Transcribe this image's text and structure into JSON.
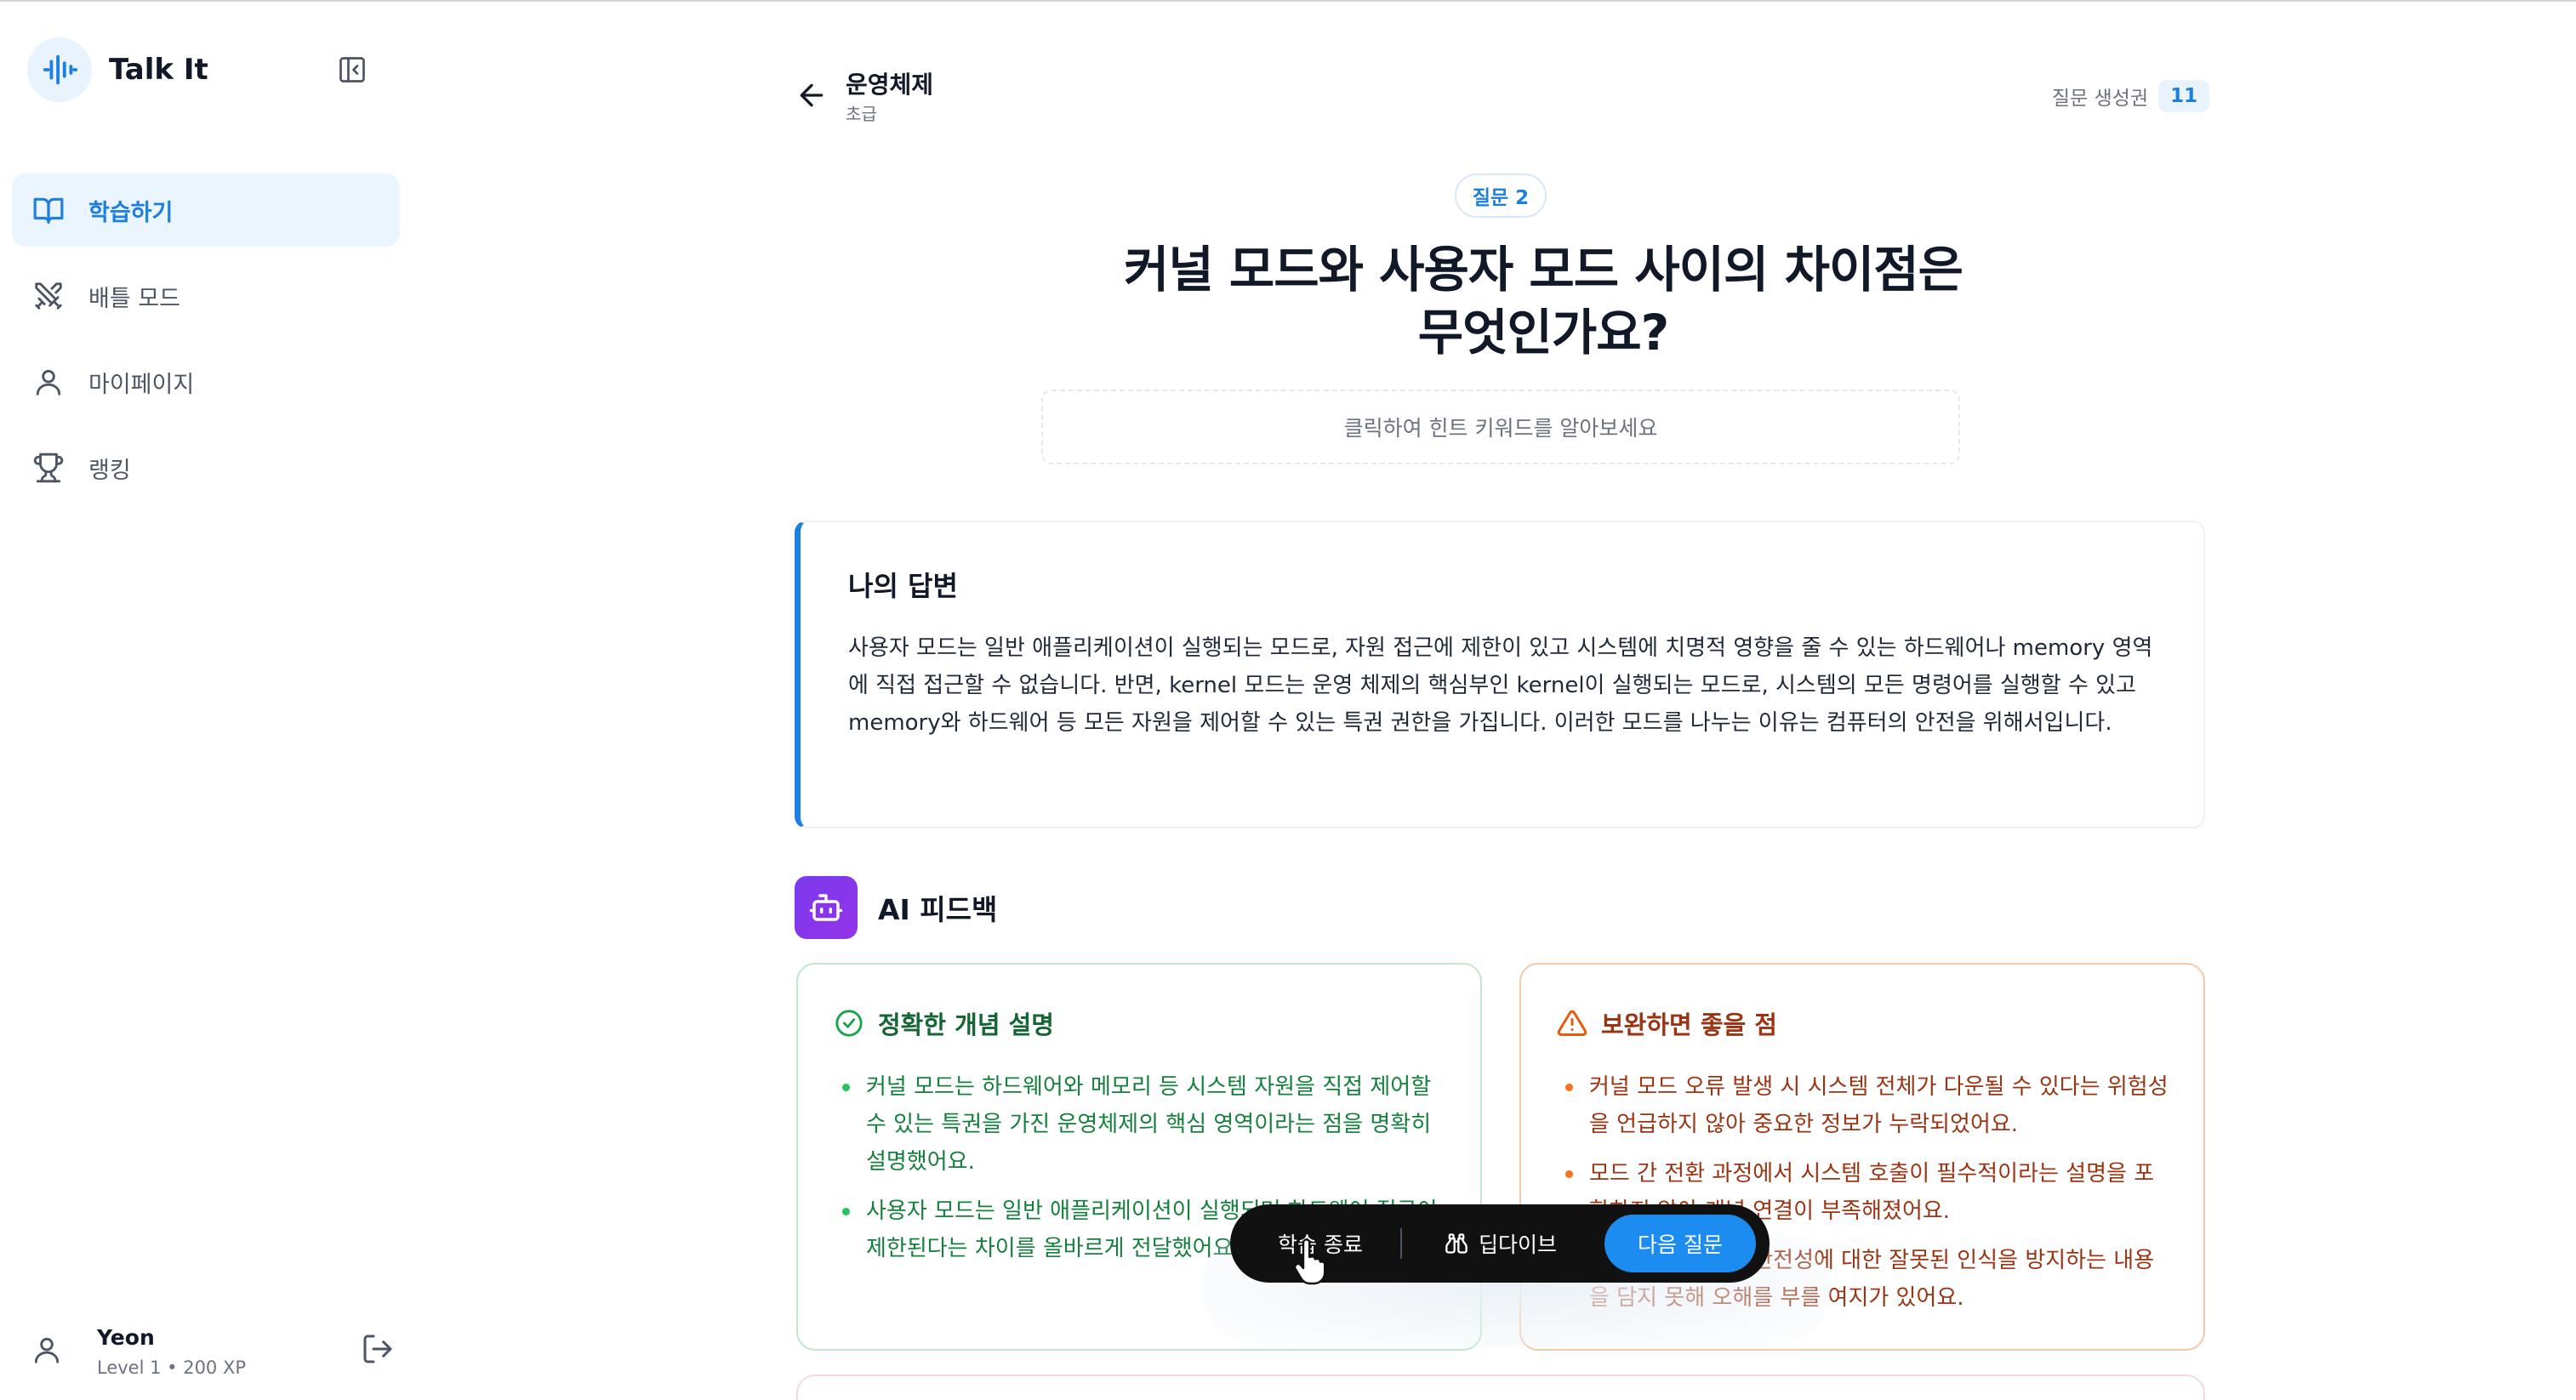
{
  "app": {
    "name": "Talk It"
  },
  "sidebar": {
    "items": [
      {
        "label": "학습하기",
        "icon": "book-open-icon",
        "active": true
      },
      {
        "label": "배틀 모드",
        "icon": "swords-icon",
        "active": false
      },
      {
        "label": "마이페이지",
        "icon": "user-icon",
        "active": false
      },
      {
        "label": "랭킹",
        "icon": "trophy-icon",
        "active": false
      }
    ],
    "user": {
      "name": "Yeon",
      "level": "Level 1 • 200 XP"
    }
  },
  "header": {
    "subject": "운영체제",
    "level": "초급",
    "ticket_label": "질문 생성권",
    "ticket_count": "11"
  },
  "question": {
    "badge": "질문 2",
    "title_line1": "커널 모드와 사용자 모드 사이의 차이점은",
    "title_line2": "무엇인가요?",
    "hint": "클릭하여 힌트 키워드를 알아보세요"
  },
  "answer": {
    "title": "나의 답변",
    "text": "사용자 모드는 일반 애플리케이션이 실행되는 모드로, 자원 접근에 제한이 있고 시스템에 치명적 영향을 줄 수 있는 하드웨어나 memory 영역에 직접 접근할 수 없습니다. 반면, kernel 모드는 운영 체제의 핵심부인 kernel이 실행되는 모드로, 시스템의 모든 명령어를 실행할 수 있고 memory와 하드웨어 등 모든 자원을 제어할 수 있는 특권 권한을 가집니다. 이러한 모드를 나누는 이유는 컴퓨터의 안전을 위해서입니다."
  },
  "feedback": {
    "title": "AI 피드백",
    "good": {
      "title": "정확한 개념 설명",
      "items": [
        "커널 모드는 하드웨어와 메모리 등 시스템 자원을 직접 제어할 수 있는 특권을 가진 운영체제의 핵심 영역이라는 점을 명확히 설명했어요.",
        "사용자 모드는 일반 애플리케이션이 실행되며 하드웨어 접근이 제한된다는 차이를 올바르게 전달했어요."
      ]
    },
    "warn": {
      "title": "보완하면 좋을 점",
      "items": [
        "커널 모드 오류 발생 시 시스템 전체가 다운될 수 있다는 위험성을 언급하지 않아 중요한 정보가 누락되었어요.",
        "모드 간 전환 과정에서 시스템 호출이 필수적이라는 설명을 포함하지 않아 개념 연결이 부족해졌어요.",
        "커널 모드 자체의 안전성에 대한 잘못된 인식을 방지하는 내용을 담지 못해 오해를 부를 여지가 있어요."
      ]
    }
  },
  "actions": {
    "end": "학습 종료",
    "deep_dive": "딥다이브",
    "next": "다음 질문"
  },
  "colors": {
    "primary": "#1d8cf0",
    "good": "#22c55e",
    "warn": "#f97316",
    "ai": "#7c3aed"
  }
}
